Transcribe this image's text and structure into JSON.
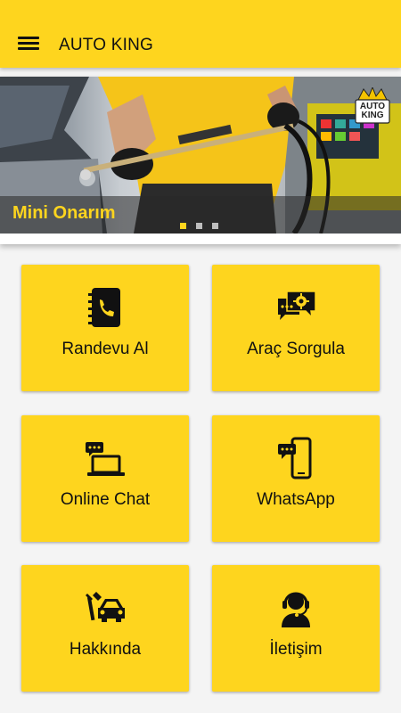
{
  "appbar": {
    "menu_icon": "hamburger-menu-icon",
    "title": "AUTO KING"
  },
  "banner": {
    "caption": "Mini Onarım",
    "logo_line1": "AUTO",
    "logo_line2": "KING",
    "slide_count": 3,
    "active_slide": 1
  },
  "tiles": [
    {
      "label": "Randevu Al",
      "icon": "phone-book-icon"
    },
    {
      "label": "Araç Sorgula",
      "icon": "chat-gear-icon"
    },
    {
      "label": "Online Chat",
      "icon": "laptop-chat-icon"
    },
    {
      "label": "WhatsApp",
      "icon": "mobile-chat-icon"
    },
    {
      "label": "Hakkında",
      "icon": "tools-car-icon"
    },
    {
      "label": "İletişim",
      "icon": "support-agent-icon"
    }
  ],
  "colors": {
    "accent": "#fed51e",
    "text": "#111111",
    "background": "#f4f4f4"
  }
}
